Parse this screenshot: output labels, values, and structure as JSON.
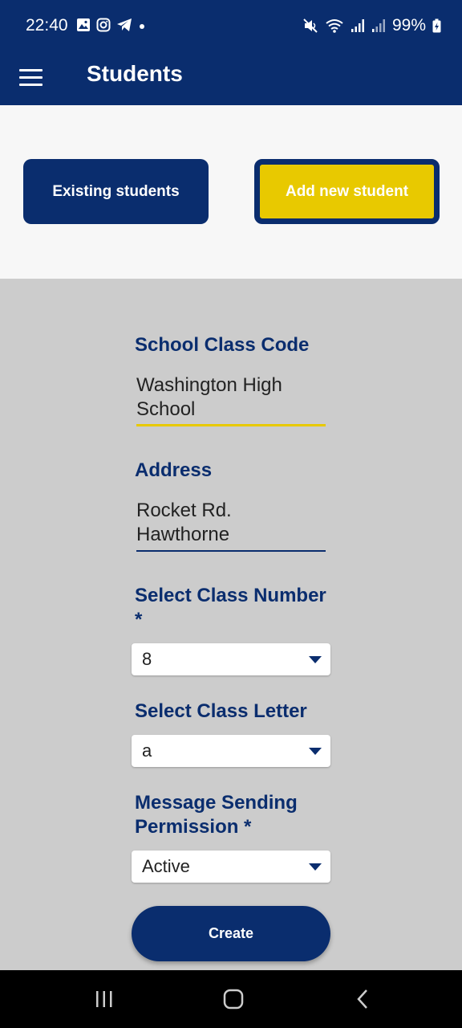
{
  "status_bar": {
    "time": "22:40",
    "battery": "99%"
  },
  "app_bar": {
    "title": "Students"
  },
  "tabs": {
    "existing_label": "Existing students",
    "add_label": "Add new student"
  },
  "form": {
    "school_class_code": {
      "label": "School Class Code",
      "value_line1": "Washington High",
      "value_line2": "School"
    },
    "address": {
      "label": "Address",
      "value_line1": "Rocket Rd.",
      "value_line2": "Hawthorne"
    },
    "class_number": {
      "label": "Select Class Number",
      "required_mark": "*",
      "value": "8"
    },
    "class_letter": {
      "label": "Select Class Letter",
      "value": "a"
    },
    "message_permission": {
      "label_line1": "Message Sending",
      "label_line2": "Permission *",
      "value": "Active"
    },
    "create_label": "Create"
  },
  "colors": {
    "primary": "#0a2d6e",
    "accent": "#e8c900",
    "form_bg": "#cccccc",
    "tabs_bg": "#f7f7f7"
  }
}
